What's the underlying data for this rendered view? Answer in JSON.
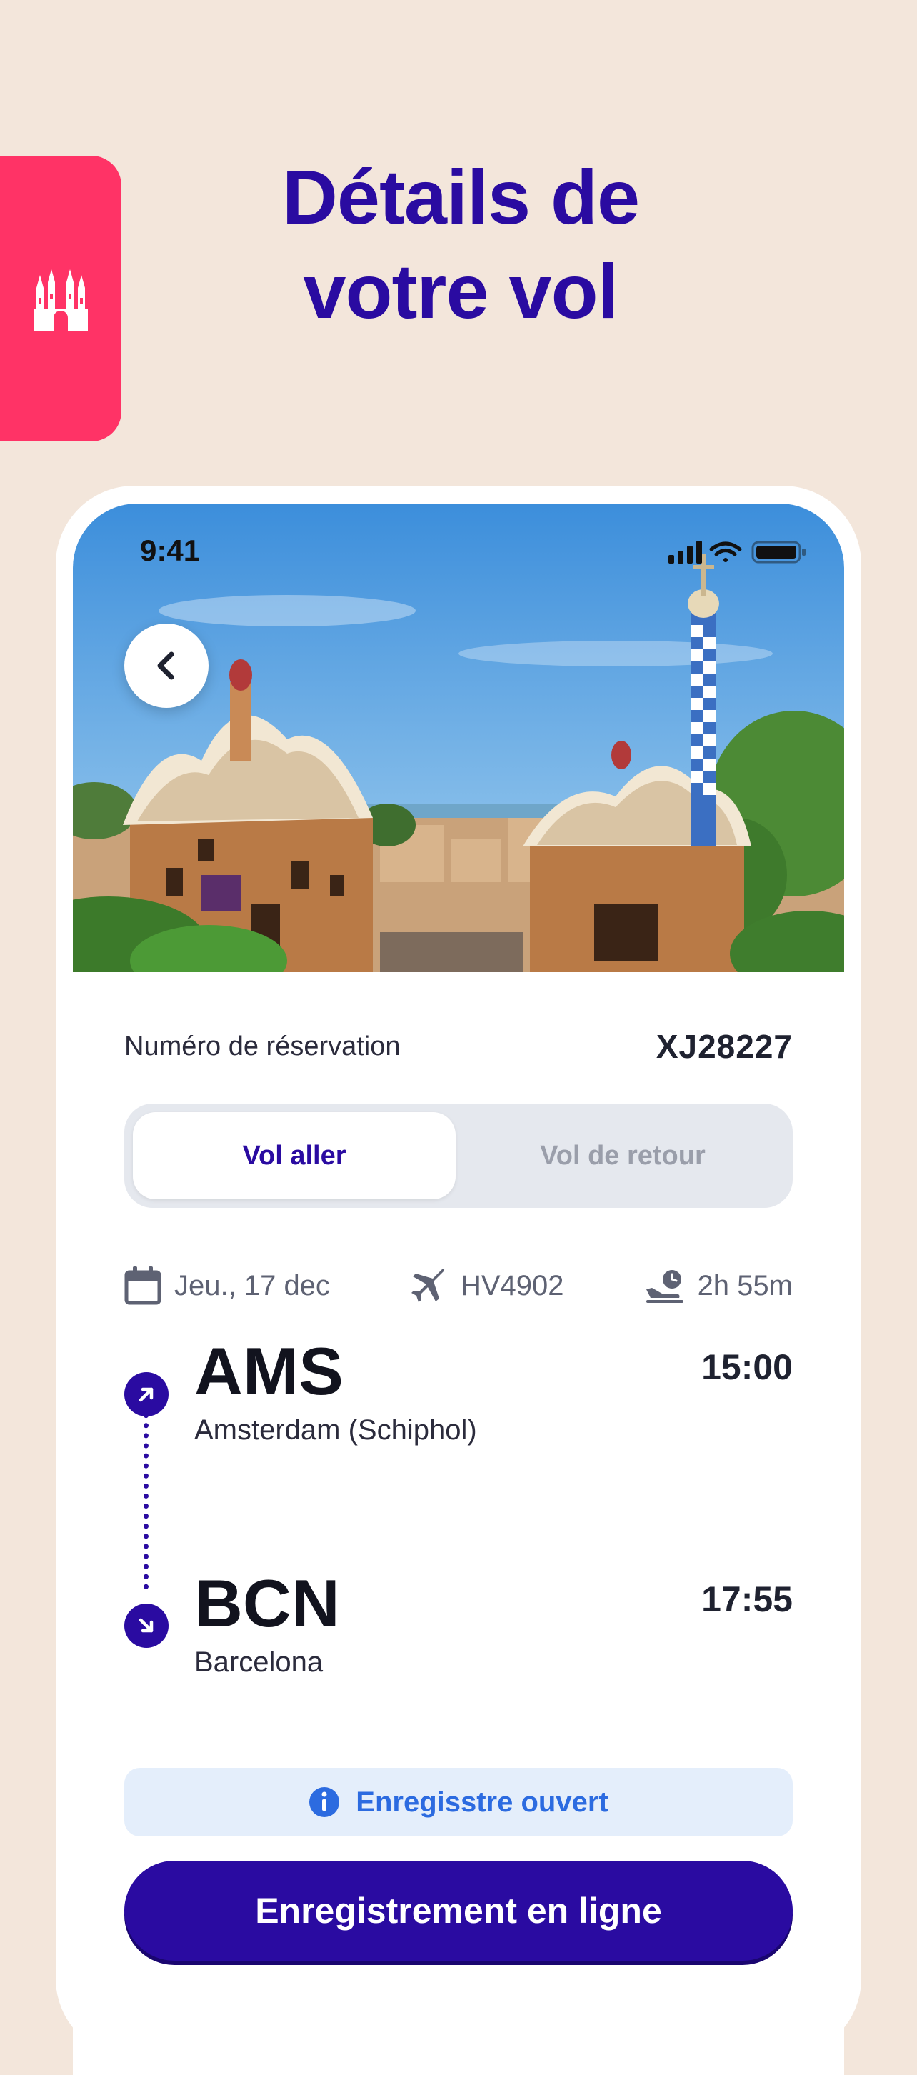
{
  "headline": {
    "line1": "Détails de",
    "line2": "votre vol"
  },
  "side_tag": {
    "icon": "sagrada-familia-icon",
    "color": "#FF3366"
  },
  "status_bar": {
    "time": "9:41"
  },
  "reservation": {
    "label": "Numéro de réservation",
    "code": "XJ28227"
  },
  "tabs": [
    {
      "label": "Vol aller",
      "active": true
    },
    {
      "label": "Vol de retour",
      "active": false
    }
  ],
  "flight_info": {
    "date": "Jeu., 17 dec",
    "flight_number": "HV4902",
    "duration": "2h 55m"
  },
  "departure": {
    "code": "AMS",
    "city": "Amsterdam (Schiphol)",
    "time": "15:00"
  },
  "arrival": {
    "code": "BCN",
    "city": "Barcelona",
    "time": "17:55"
  },
  "checkin_status": "Enregisstre ouvert",
  "cta_label": "Enregistrement en ligne",
  "colors": {
    "primary": "#2A0BA1",
    "background": "#F3E6DB",
    "accent": "#FF3366",
    "info": "#2C6BE0"
  }
}
